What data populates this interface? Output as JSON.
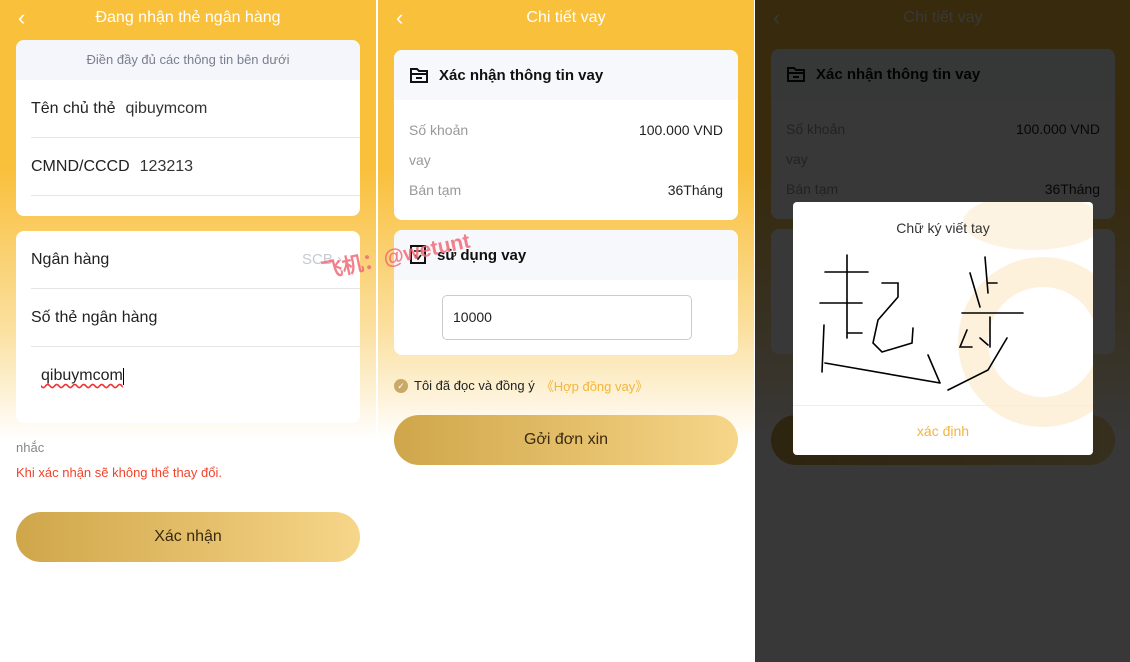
{
  "watermark": "飞机：@wetunt",
  "screen1": {
    "title": "Đang nhận thẻ ngân hàng",
    "hint": "Điền đầy đủ các thông tin bên dưới",
    "holder_label": "Tên chủ thẻ",
    "holder_value": "qibuymcom",
    "id_label": "CMND/CCCD",
    "id_value": "123213",
    "bank_label": "Ngân hàng",
    "bank_value": "SCB",
    "card_no_label": "Số thẻ ngân hàng",
    "card_no_value": "qibuymcom",
    "remind_label": "nhắc",
    "warning": "Khi xác nhận sẽ không thể thay đổi.",
    "confirm_button": "Xác nhận"
  },
  "screen2": {
    "title": "Chi tiết vay",
    "info_title": "Xác nhận thông tin vay",
    "amount_label_1": "Số khoản",
    "amount_label_2": "vay",
    "amount_value": "100.000 VND",
    "term_label": "Bán tạm",
    "term_value": "36Tháng",
    "usage_title": "sử dụng vay",
    "usage_value": "10000",
    "agree_text": "Tôi đã đọc và đồng ý",
    "contract_link": "《Hợp đồng vay》",
    "submit_button": "Gởi đơn xin"
  },
  "modal": {
    "title": "Chữ ký viết tay",
    "confirm": "xác định"
  },
  "colors": {
    "primary": "#f9c03c",
    "accent": "#f3b53d",
    "warning": "#f0442c"
  }
}
